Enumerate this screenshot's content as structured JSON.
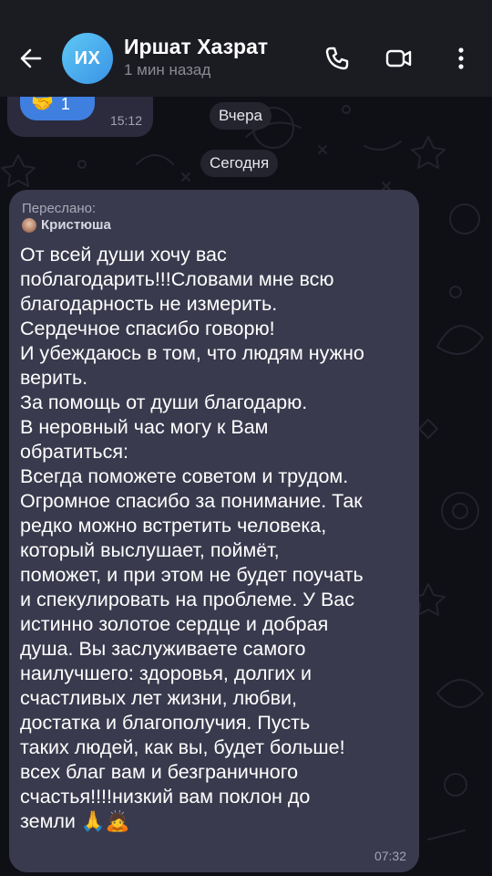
{
  "header": {
    "avatar_initials": "ИХ",
    "title": "Иршат Хазрат",
    "subtitle": "1 мин назад",
    "back_icon": "arrow-left-icon",
    "call_icon": "phone-icon",
    "video_icon": "video-camera-icon",
    "menu_icon": "more-vertical-icon"
  },
  "previous_message": {
    "reaction_emoji": "🤝",
    "reaction_count": "1",
    "time": "15:12"
  },
  "dates": {
    "yesterday": "Вчера",
    "today": "Сегодня"
  },
  "message": {
    "forwarded_label": "Переслано:",
    "forwarded_from": "Кристюша",
    "lines": [
      "От всей души хочу вас",
      "поблагодарить!!!Словами мне всю",
      "благодарность не измерить.",
      "Сердечное спасибо говорю!",
      "И убеждаюсь в том, что людям нужно",
      "верить.",
      "За помощь от души благодарю.",
      "В неровный час могу к Вам",
      "обратиться:",
      "Всегда поможете советом и трудом.",
      "Огромное спасибо за понимание. Так",
      "редко можно встретить человека,",
      "который выслушает, поймёт,",
      "поможет, и при этом не будет поучать",
      "и спекулировать на проблеме. У Вас",
      "истинно золотое сердце и добрая",
      "душа. Вы заслуживаете самого",
      "наилучшего: здоровья, долгих и",
      "счастливых лет жизни, любви,",
      "достатка и благополучия. Пусть",
      "таких людей, как вы, будет больше!",
      "всех благ вам и безграничного",
      "счастья!!!!низкий вам поклон до",
      "земли 🙏🙇"
    ],
    "time": "07:32"
  },
  "colors": {
    "header_bg": "#1b1b22",
    "bubble_bg": "#3a3a4e",
    "accent": "#3f7fe0",
    "avatar_gradient_start": "#5ec8f4",
    "avatar_gradient_end": "#3a93e6"
  }
}
